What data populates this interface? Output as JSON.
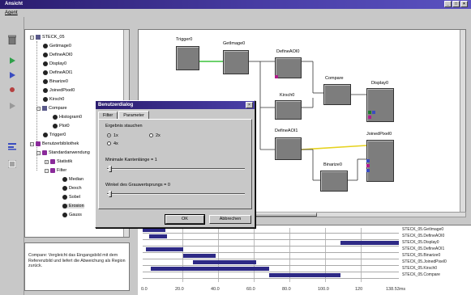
{
  "window": {
    "title": "Ansicht",
    "menu": "Agent"
  },
  "toolbar": {
    "icons": [
      "trash-icon",
      "run-icon",
      "step-icon",
      "stop-icon",
      "debug-icon",
      "align-icon",
      "list-icon"
    ]
  },
  "tree": {
    "items": [
      {
        "label": "STECK_05",
        "icon": "root"
      },
      {
        "label": "Getimage0",
        "icon": "op"
      },
      {
        "label": "DefineAOI0",
        "icon": "op"
      },
      {
        "label": "Display0",
        "icon": "op"
      },
      {
        "label": "DefineAOI1",
        "icon": "op"
      },
      {
        "label": "Binarize0",
        "icon": "op"
      },
      {
        "label": "JoinedPixel0",
        "icon": "op"
      },
      {
        "label": "Kirsch0",
        "icon": "op"
      },
      {
        "label": "Compare",
        "icon": "box"
      },
      {
        "label": "Histogram0",
        "icon": "op"
      },
      {
        "label": "Plot0",
        "icon": "op"
      },
      {
        "label": "Trigger0",
        "icon": "op"
      },
      {
        "label": "Benutzerbibliothek",
        "icon": "lib"
      },
      {
        "label": "Standardanwendung",
        "icon": "lib"
      },
      {
        "label": "Statistik",
        "icon": "lib"
      },
      {
        "label": "Filter",
        "icon": "lib"
      },
      {
        "label": "Median",
        "icon": "op"
      },
      {
        "label": "Dexch",
        "icon": "op"
      },
      {
        "label": "Sobel",
        "icon": "op"
      },
      {
        "label": "Erosion",
        "icon": "op"
      },
      {
        "label": "Gauss",
        "icon": "op"
      }
    ]
  },
  "description": "Compare: Vergleicht das Eingangsbild mit dem Referenzbild und liefert die Abweichung als Region zurück.",
  "canvas": {
    "nodes": [
      {
        "label": "Trigger0"
      },
      {
        "label": "GetImage0"
      },
      {
        "label": "DefineAOI0"
      },
      {
        "label": "Kirsch0"
      },
      {
        "label": "Compare"
      },
      {
        "label": "Display0"
      },
      {
        "label": "DefineAOI1"
      },
      {
        "label": "Binarize0"
      },
      {
        "label": "JoinedPixel0"
      }
    ]
  },
  "dialog": {
    "title": "Benutzerdialog",
    "tabs": [
      "Filter",
      "Parameter"
    ],
    "active_tab": "Parameter",
    "group_label": "Ergebnis stauchen",
    "radios": [
      "1x",
      "2x",
      "4x"
    ],
    "selected_radio": "1x",
    "slider1_label": "Minimale Kantenlänge = 1",
    "slider2_label": "Winkel des Grauwertsprungs = 0",
    "ok_label": "OK",
    "cancel_label": "Abbrechen"
  },
  "gantt": {
    "rows": [
      {
        "label": "STECK_05.GetImage0"
      },
      {
        "label": "STECK_05.DefineAOI0"
      },
      {
        "label": "STECK_05.Display0"
      },
      {
        "label": "STECK_05.DefineAOI1"
      },
      {
        "label": "STECK_05.Binarize0"
      },
      {
        "label": "STECK_05.JoinedPixel0"
      },
      {
        "label": "STECK_05.Kirsch0"
      },
      {
        "label": "STECK_05.Compare"
      }
    ],
    "ticks": [
      "0.0",
      "20.0",
      "40.0",
      "60.0",
      "80.0",
      "100.0",
      "120",
      "138.53ms"
    ],
    "bar_color": "#2e2a86"
  },
  "colors": {
    "titlebar": "#2a1c6e",
    "link_green": "#3cc43c",
    "link_yellow": "#e6d21e"
  }
}
